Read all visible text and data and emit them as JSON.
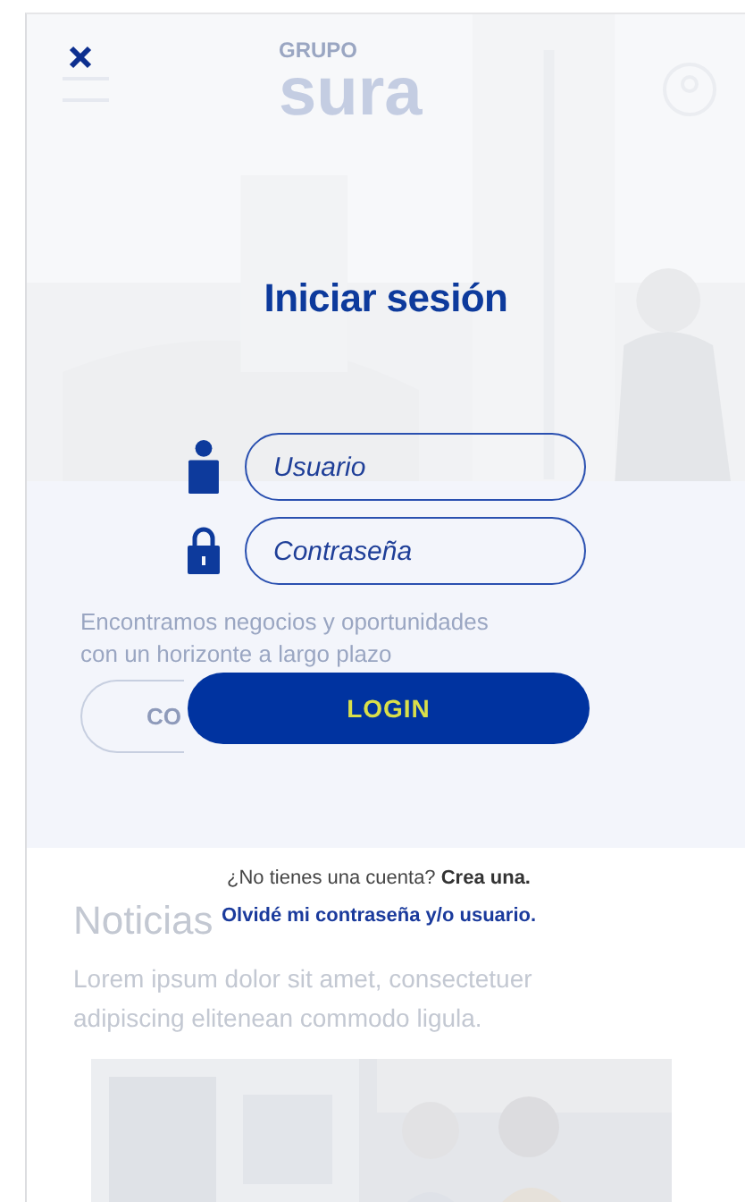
{
  "background_page": {
    "logo_top": "GRUPO",
    "logo_main": "sura",
    "hero_text": "Encontramos negocios y oportunidades con un horizonte a largo plazo",
    "hero_button": "CO",
    "news_heading": "Noticias",
    "news_text": "Lorem ipsum dolor sit amet, consectetuer adipiscing elitenean commodo ligula."
  },
  "login": {
    "title": "Iniciar sesión",
    "fields": [
      {
        "kind": "user",
        "placeholder": "Usuario"
      },
      {
        "kind": "password",
        "placeholder": "Contraseña"
      }
    ],
    "button": "LOGIN",
    "signup_prompt": "¿No tienes una cuenta?",
    "signup_link": "Crea una.",
    "forgot_link": "Olvidé mi contraseña y/o usuario."
  }
}
